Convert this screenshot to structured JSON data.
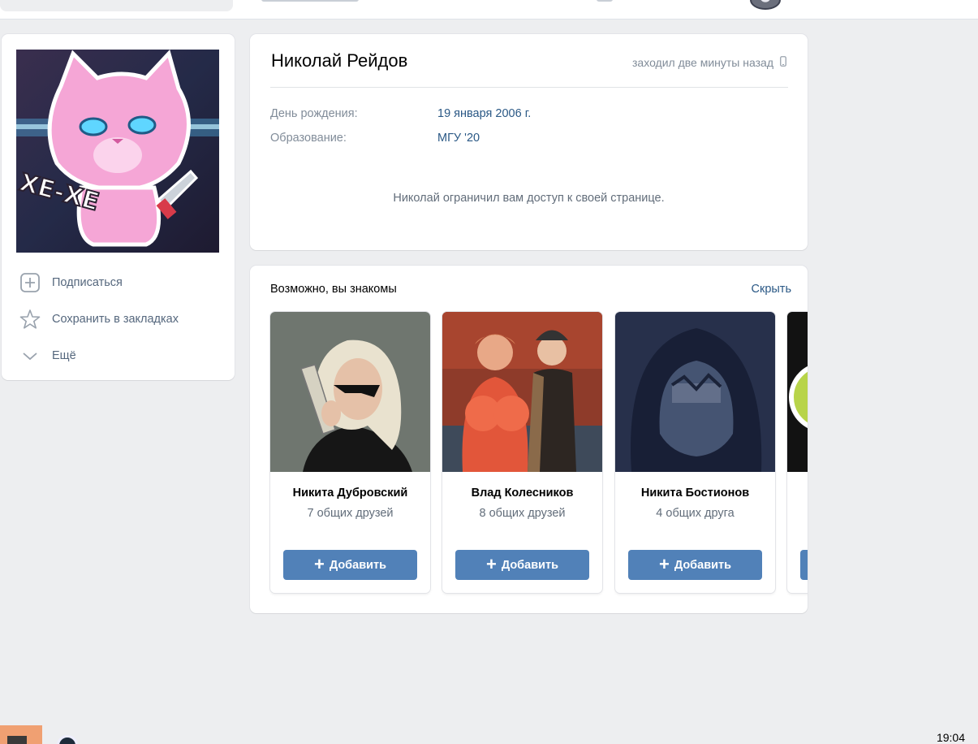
{
  "colors": {
    "accent": "#5181b8",
    "link": "#2a5885",
    "muted": "#818c99",
    "background": "#edeef0"
  },
  "sidebar": {
    "avatar_caption": "ХЕ-ХЕ",
    "items": [
      {
        "label": "Подписаться",
        "icon": "plus-square-icon"
      },
      {
        "label": "Сохранить в закладках",
        "icon": "star-icon"
      },
      {
        "label": "Ещё",
        "icon": "chevron-down-icon"
      }
    ]
  },
  "profile": {
    "name": "Николай Рейдов",
    "last_seen": "заходил две минуты назад",
    "last_seen_icon": "mobile-phone-icon",
    "fields": [
      {
        "label": "День рождения:",
        "value": "19 января 2006 г."
      },
      {
        "label": "Образование:",
        "value": "МГУ '20"
      }
    ],
    "restricted_message": "Николай ограничил вам доступ к своей странице."
  },
  "suggestions": {
    "title": "Возможно, вы знакомы",
    "hide_label": "Скрыть",
    "add_label": "Добавить",
    "friends": [
      {
        "name": "Никита Дубровский",
        "mutual": "7 общих друзей"
      },
      {
        "name": "Влад Колесников",
        "mutual": "8 общих друзей"
      },
      {
        "name": "Никита Бостионов",
        "mutual": "4 общих друга"
      }
    ]
  },
  "taskbar": {
    "clock": "19:04"
  }
}
